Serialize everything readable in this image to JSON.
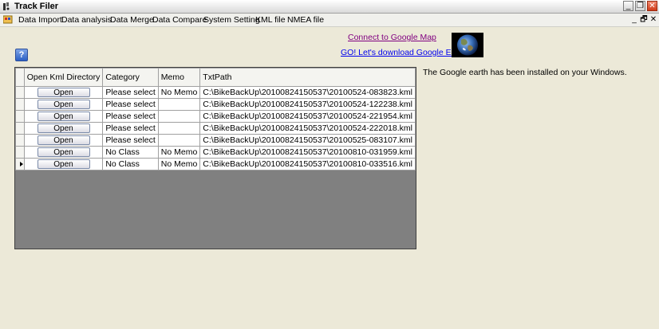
{
  "window": {
    "title": "Track Filer",
    "minimize_glyph": "_",
    "maximize_glyph": "❐",
    "close_glyph": "✕"
  },
  "menubar": {
    "items": [
      "Data Import",
      "Data analysis",
      "Data Merge",
      "Data Compare",
      "System Setting",
      "KML file",
      "NMEA file"
    ],
    "mdi_minimize": "_",
    "mdi_restore": "🗗",
    "mdi_close": "✕"
  },
  "help_button": {
    "label": "?"
  },
  "links": {
    "connect_map": "Connect to Google Map",
    "download_earth": "GO! Let's download Google Earth"
  },
  "status_text": "The Google earth has been installed on your Windows.",
  "grid": {
    "columns": [
      "Open Kml Directory",
      "Category",
      "Memo",
      "TxtPath"
    ],
    "rows": [
      {
        "button": "Open",
        "category": "Please select",
        "memo": "No Memo",
        "path": "C:\\BikeBackUp\\20100824150537\\20100524-083823.kml",
        "selected": false
      },
      {
        "button": "Open",
        "category": "Please select",
        "memo": "",
        "path": "C:\\BikeBackUp\\20100824150537\\20100524-122238.kml",
        "selected": false
      },
      {
        "button": "Open",
        "category": "Please select",
        "memo": "",
        "path": "C:\\BikeBackUp\\20100824150537\\20100524-221954.kml",
        "selected": false
      },
      {
        "button": "Open",
        "category": "Please select",
        "memo": "",
        "path": "C:\\BikeBackUp\\20100824150537\\20100524-222018.kml",
        "selected": false
      },
      {
        "button": "Open",
        "category": "Please select",
        "memo": "",
        "path": "C:\\BikeBackUp\\20100824150537\\20100525-083107.kml",
        "selected": false
      },
      {
        "button": "Open",
        "category": "No Class",
        "memo": "No Memo",
        "path": "C:\\BikeBackUp\\20100824150537\\20100810-031959.kml",
        "selected": false
      },
      {
        "button": "Open",
        "category": "No Class",
        "memo": "No Memo",
        "path": "C:\\BikeBackUp\\20100824150537\\20100810-033516.kml",
        "selected": true
      }
    ]
  },
  "colors": {
    "background": "#ECE9D8",
    "grid_background": "#808080",
    "link_visited": "#800080",
    "link": "#0000EE"
  },
  "icons": {
    "app": "satellite-dish-icon",
    "menu": "app-menu-icon",
    "earth": "earth-globe-icon",
    "help": "help-icon"
  }
}
